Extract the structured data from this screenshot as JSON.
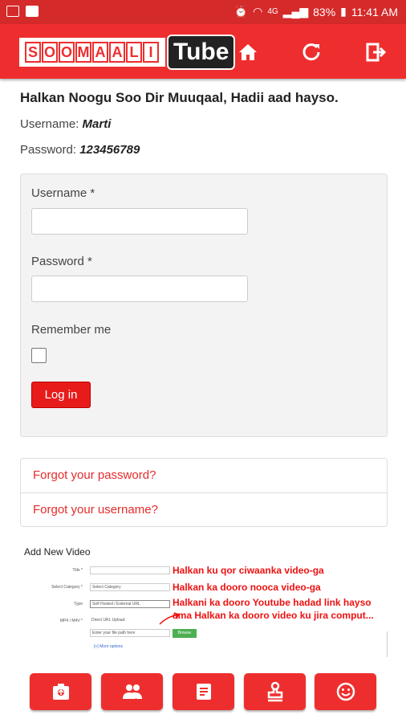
{
  "status_bar": {
    "battery": "83%",
    "time": "11:41 AM",
    "network": "4G"
  },
  "logo": {
    "left_text": [
      "S",
      "O",
      "O",
      "M",
      "A",
      "A",
      "L",
      "I"
    ],
    "right_text": "Tube"
  },
  "nav": {
    "icons": [
      "home-icon",
      "refresh-icon",
      "logout-icon"
    ]
  },
  "heading": "Halkan Noogu Soo Dir Muuqaal, Hadii aad hayso.",
  "credentials": {
    "username_label": "Username:",
    "username_value": "Marti",
    "password_label": "Password:",
    "password_value": "123456789"
  },
  "form": {
    "username_label": "Username *",
    "password_label": "Password *",
    "remember_label": "Remember me",
    "login_button": "Log in"
  },
  "links": {
    "forgot_password": "Forgot your password?",
    "forgot_username": "Forgot your username?"
  },
  "instruction": {
    "title": "Add New Video",
    "fields": [
      {
        "label": "Title *",
        "value": ""
      },
      {
        "label": "Select Category *",
        "value": "Select Category"
      },
      {
        "label": "Type",
        "value": "Self Hosted / External URL"
      },
      {
        "label": "MP4 / M4V *",
        "value": "Direct URL    Upload"
      }
    ],
    "path_placeholder": "Enter your file path here",
    "browse": "Browse",
    "more": "[+] More options",
    "notes": [
      "Halkan ku qor ciwaanka video-ga",
      "Halkan ka dooro nooca video-ga",
      "Halkani ka dooro Youtube hadad link hayso",
      "ama Halkan ka dooro video ku jira comput..."
    ]
  },
  "bottom_nav": {
    "icons": [
      "camera-upload-icon",
      "users-icon",
      "document-icon",
      "stamp-icon",
      "smiley-icon"
    ]
  },
  "colors": {
    "primary": "#ee2e2e",
    "status_bar": "#d52a2a",
    "link": "#e52b2b"
  }
}
